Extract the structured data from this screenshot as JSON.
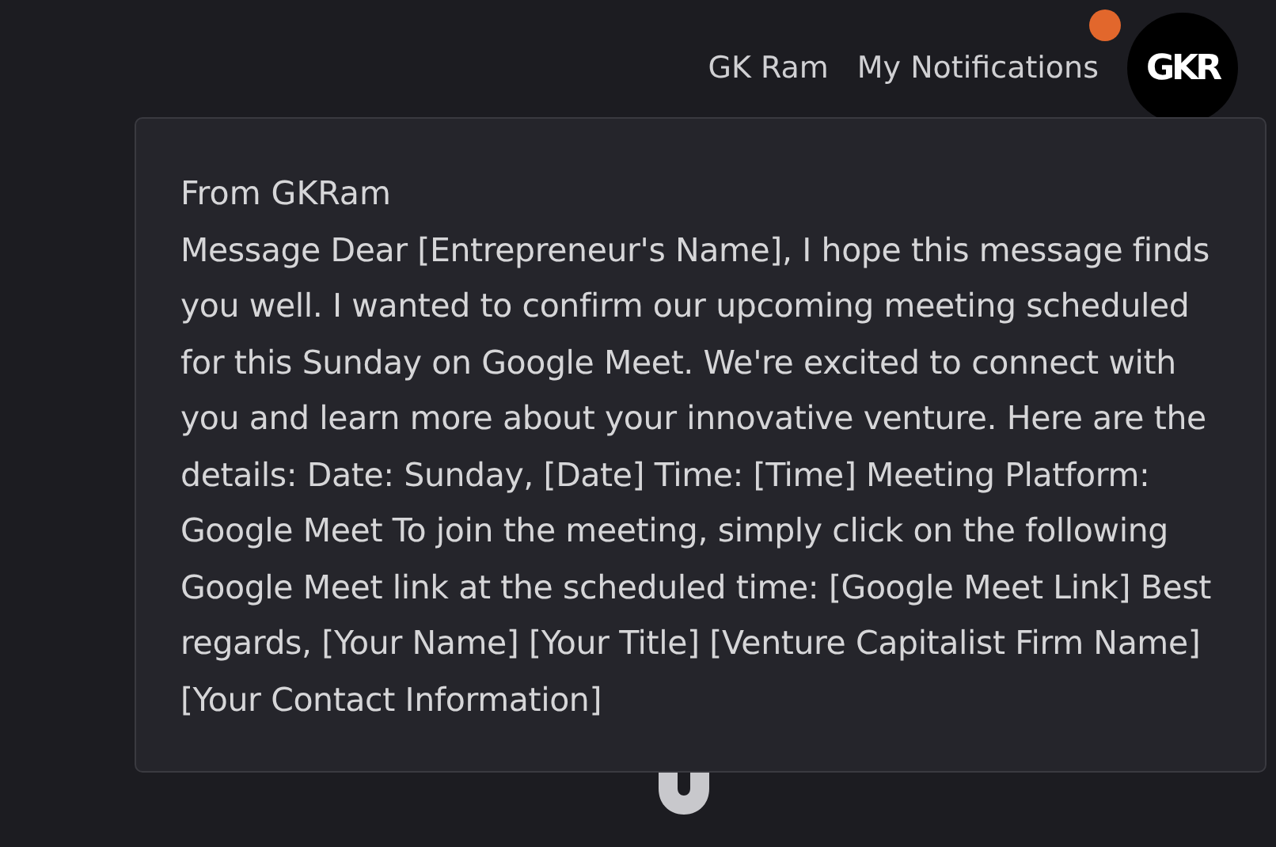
{
  "header": {
    "user_name": "GK Ram",
    "notifications_link": "My Notifications",
    "has_unread": true,
    "avatar_text": "GKR"
  },
  "notification_popup": {
    "from": "From GKRam",
    "message": "Message Dear [Entrepreneur's Name], I hope this message finds you well. I wanted to confirm our upcoming meeting scheduled for this Sunday on Google Meet. We're excited to connect with you and learn more about your innovative venture. Here are the details: Date: Sunday, [Date] Time: [Time] Meeting Platform: Google Meet To join the meeting, simply click on the following Google Meet link at the scheduled time: [Google Meet Link] Best regards, [Your Name] [Your Title] [Venture Capitalist Firm Name] [Your Contact Information]"
  }
}
